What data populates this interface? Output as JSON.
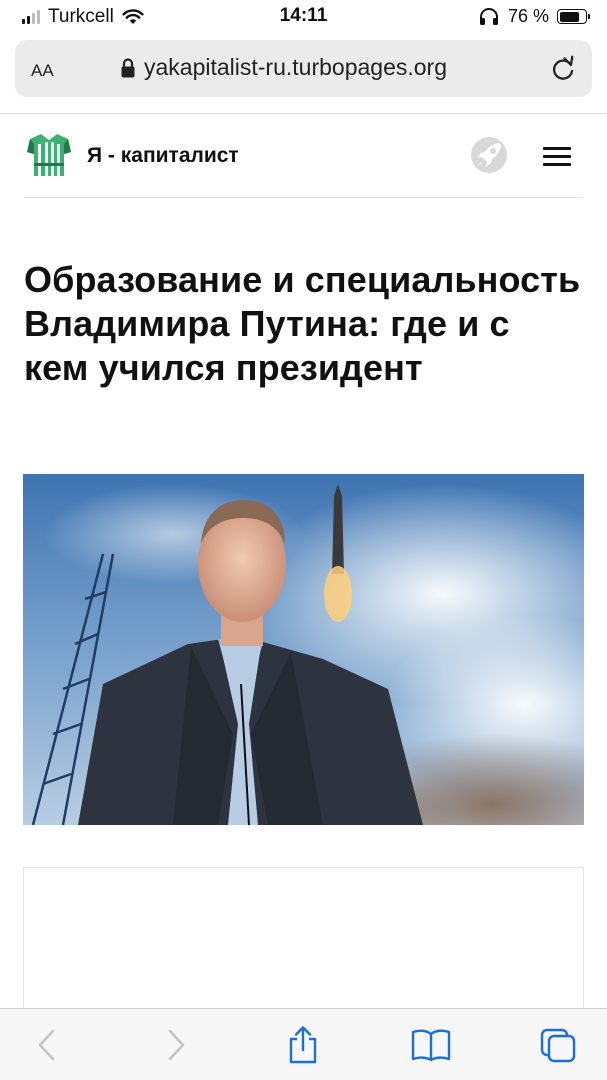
{
  "status_bar": {
    "carrier": "Turkcell",
    "time": "14:11",
    "battery_percent": "76 %",
    "battery_level": 0.76
  },
  "browser": {
    "text_size_label": "AA",
    "url": "yakapitalist-ru.turbopages.org"
  },
  "site": {
    "name": "Я - капиталист"
  },
  "article": {
    "title": "Образование и специальность Владимира Путина: где и с кем учился президент"
  },
  "colors": {
    "link_blue": "#1a6fe0",
    "toolbar_bg": "#f7f7f7",
    "address_bg": "#ebebeb",
    "logo_green": "#2e9e5b"
  },
  "icons": [
    "wifi-icon",
    "headphones-icon",
    "lock-icon",
    "reload-icon",
    "rocket-icon",
    "menu-icon",
    "back-icon",
    "forward-icon",
    "share-icon",
    "bookmarks-icon",
    "tabs-icon"
  ]
}
